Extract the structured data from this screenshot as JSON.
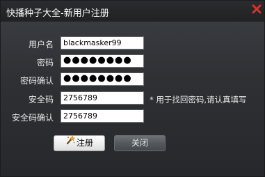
{
  "window": {
    "title": "快播种子大全-新用户注册",
    "close_icon": "close-x-icon",
    "accent_close_color": "#d8322b"
  },
  "form": {
    "username_label": "用户名",
    "username_value": "blackmasker99",
    "password_label": "密码",
    "password_value": "●●●●●●●●",
    "confirm_password_label": "密码确认",
    "confirm_password_value": "●●●●●●●●",
    "security_code_label": "安全码",
    "security_code_value": "2756789",
    "security_hint": "* 用于找回密码,请认真填写",
    "confirm_security_code_label": "安全码确认",
    "confirm_security_code_value": "2756789"
  },
  "buttons": {
    "register_label": "注册",
    "register_icon": "magic-wand-icon",
    "close_label": "关闭"
  }
}
